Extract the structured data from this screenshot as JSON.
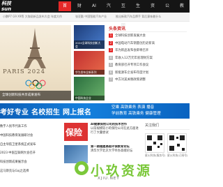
{
  "header": {
    "logo_line1": "科技",
    "logo_line2": "sun",
    "nav": [
      "首页",
      "财经",
      "AI",
      "汽车",
      "互联网",
      "生活",
      "资讯",
      "公益",
      "教育"
    ],
    "active_index": 0,
    "accent": "#e62828"
  },
  "subnav": {
    "items": [
      "小鹏P7 G9 X9等 大咖说新品发布大会 年度大作",
      "张亚勤 中国智能汽车产业",
      "推出新款汽车品牌手 背后意味着什么"
    ]
  },
  "hero": {
    "title": "PARIS 2024",
    "caption": "全球创新科技共享成果发布"
  },
  "side_cards": [
    {
      "caption": "2024全球科技创新大会"
    },
    {
      "caption": "华为发布全新系列"
    },
    {
      "caption": "中国科技企业"
    }
  ],
  "headlines": {
    "title": "头条资讯",
    "items": [
      "全球科技创新发展大会",
      "中国电动汽车销量创历史新高",
      "华为新品发布会即将召开",
      "年收入12万元年底理财方案",
      "教育部召开专项工作会议",
      "新能源车企发布年度计划",
      "中方对美关税政策调整"
    ]
  },
  "banner": {
    "left": "考好专业 名校招生 网上报名",
    "right_line1": "空乘 高铁乘务 表演 播音",
    "right_line2": "学前教育 高铁乘务 健康管理"
  },
  "left_list": [
    "数字人民币代表工作",
    "中国科技教育发展研讨会",
    "自主导航卫星系统正式发布",
    "2023 中国互联网大会召开",
    "科技创新成果展示会",
    "这马斯克与Gaj之选择"
  ],
  "mid_list": [
    {
      "thumb_text": "保险",
      "title": "AI健康保险公司的技术合作",
      "desc": "以前规模较小的保险公司在此方面进行了大量尝试"
    },
    {
      "thumb_text": "",
      "title": "第一期福建高级环保教育论坛",
      "desc": "清华大学北京大学举办高端论坛"
    }
  ],
  "follow": {
    "title": "关注我们",
    "qr_labels": [
      "星火科技(服务号)",
      "星火科技(订阅号)"
    ]
  },
  "watermark": {
    "text": "小玖资源",
    "url": "XJIU.NET"
  }
}
